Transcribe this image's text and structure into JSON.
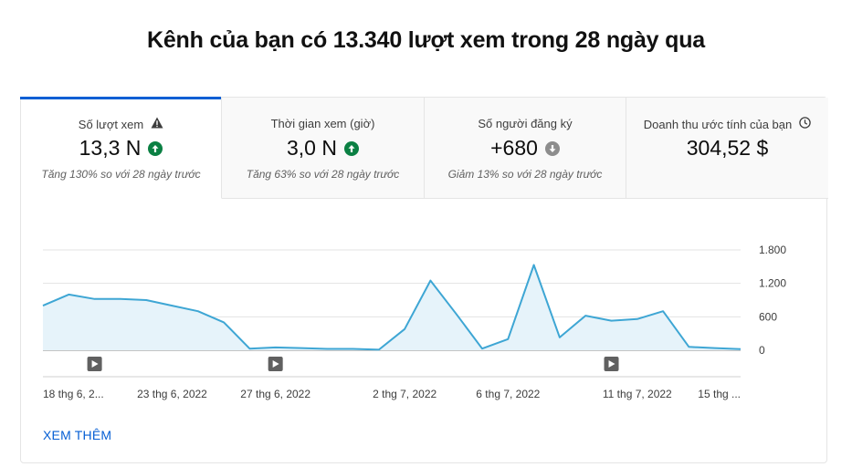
{
  "headline": "Kênh của bạn có 13.340 lượt xem trong 28 ngày qua",
  "tabs": [
    {
      "label": "Số lượt xem",
      "icon": "warning-icon",
      "value": "13,3 N",
      "trend": "up",
      "change": "Tăng 130% so với 28 ngày trước"
    },
    {
      "label": "Thời gian xem (giờ)",
      "value": "3,0 N",
      "trend": "up",
      "change": "Tăng 63% so với 28 ngày trước"
    },
    {
      "label": "Số người đăng ký",
      "value": "+680",
      "trend": "down",
      "change": "Giảm 13% so với 28 ngày trước"
    },
    {
      "label": "Doanh thu ước tính của bạn",
      "icon": "clock-icon",
      "value": "304,52 $"
    }
  ],
  "colors": {
    "accent": "#065fd4",
    "up": "#0b8043",
    "down": "#8d8d8d",
    "line": "#3ea6d4",
    "fill": "#e6f3fa"
  },
  "chart_data": {
    "type": "area",
    "x": [
      "18 thg 6, 2022",
      "19 thg 6, 2022",
      "20 thg 6, 2022",
      "21 thg 6, 2022",
      "22 thg 6, 2022",
      "23 thg 6, 2022",
      "24 thg 6, 2022",
      "25 thg 6, 2022",
      "26 thg 6, 2022",
      "27 thg 6, 2022",
      "28 thg 6, 2022",
      "29 thg 6, 2022",
      "30 thg 6, 2022",
      "1 thg 7, 2022",
      "2 thg 7, 2022",
      "3 thg 7, 2022",
      "4 thg 7, 2022",
      "5 thg 7, 2022",
      "6 thg 7, 2022",
      "7 thg 7, 2022",
      "8 thg 7, 2022",
      "9 thg 7, 2022",
      "10 thg 7, 2022",
      "11 thg 7, 2022",
      "12 thg 7, 2022",
      "13 thg 7, 2022",
      "14 thg 7, 2022",
      "15 thg 7, 2022"
    ],
    "values": [
      800,
      1000,
      920,
      920,
      900,
      800,
      700,
      500,
      30,
      50,
      40,
      25,
      25,
      10,
      380,
      1250,
      650,
      30,
      200,
      1530,
      230,
      620,
      530,
      560,
      700,
      60,
      40,
      20
    ],
    "ylim": [
      0,
      1800
    ],
    "yticks": [
      "1.800",
      "1.200",
      "600",
      "0"
    ],
    "ytick_values": [
      1800,
      1200,
      600,
      0
    ],
    "xtick_labels": [
      "18 thg 6, 2...",
      "23 thg 6, 2022",
      "27 thg 6, 2022",
      "2 thg 7, 2022",
      "6 thg 7, 2022",
      "11 thg 7, 2022",
      "15 thg ..."
    ],
    "xtick_index": [
      0,
      5,
      9,
      14,
      18,
      23,
      27
    ],
    "video_markers": [
      2,
      9,
      22
    ],
    "grid": true
  },
  "see_more": "XEM THÊM"
}
